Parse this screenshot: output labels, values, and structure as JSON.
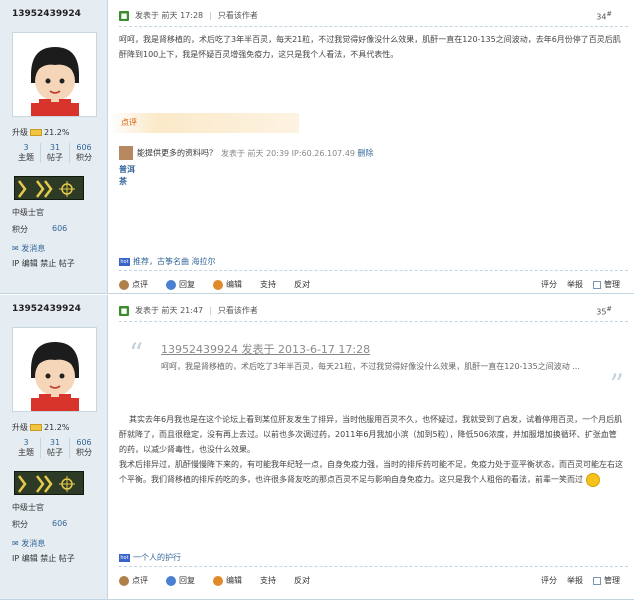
{
  "posts": [
    {
      "author": "13952439924",
      "level_label": "升级",
      "level_pct": "21.2%",
      "stats": [
        {
          "num": "3",
          "label": "主题"
        },
        {
          "num": "31",
          "label": "帖子"
        },
        {
          "num": "606",
          "label": "积分"
        }
      ],
      "rank": "中级士官",
      "points_label": "积分",
      "points": "606",
      "send_msg": "发消息",
      "admin": "IP 编辑 禁止 帖子",
      "posted": "发表于 前天 17:28",
      "only_author": "只看该作者",
      "floor": "34",
      "floor_suffix": "#",
      "content": "呵呵，我是肾移植的，术后吃了3年半百灵，每天21粒，不过我觉得好像没什么效果，肌酐一直在120-135之间波动，去年6月份停了百灵后肌酐降到100上下，我是怀疑百灵增强免疫力，这只是我个人看法，不具代表性。",
      "review_label": "点评",
      "comment": {
        "question": "能提供更多的资料吗？",
        "meta": "发表于 前天 20:39 IP:60.26.107.49",
        "delete": "删除",
        "user_line1": "普洱",
        "user_line2": "茶"
      },
      "link": "推荐，古筝名曲 海拉尔",
      "actions": [
        "点评",
        "回复",
        "编辑",
        "支持",
        "反对"
      ],
      "right_actions": [
        "评分",
        "举报",
        "管理"
      ]
    },
    {
      "author": "13952439924",
      "level_label": "升级",
      "level_pct": "21.2%",
      "stats": [
        {
          "num": "3",
          "label": "主题"
        },
        {
          "num": "31",
          "label": "帖子"
        },
        {
          "num": "606",
          "label": "积分"
        }
      ],
      "rank": "中级士官",
      "points_label": "积分",
      "points": "606",
      "send_msg": "发消息",
      "admin": "IP 编辑 禁止 帖子",
      "posted": "发表于 前天 21:47",
      "only_author": "只看该作者",
      "floor": "35",
      "floor_suffix": "#",
      "quote_head": "13952439924 发表于 2013-6-17 17:28",
      "quote_body": "呵呵，我是肾移植的，术后吃了3年半百灵，每天21粒，不过我觉得好像没什么效果，肌酐一直在120-135之间波动 ...",
      "content": "其实去年6月我也是在这个论坛上看到某位肝友发生了排异，当时他服用百灵不久，也怀疑过，我就受到了启发，试着停用百灵，一个月后肌酐就降了，而且很稳定，没有再上去过。以前也多次调过药，2011年6月我加小滨（加到5粒），降低506浓度，并加服增加换循环、扩张血管的药，以减少肾毒性，也没什么效果。\n我术后排异过，肌酐慢慢降下来的，有可能我年纪轻一点，自身免疫力强，当时的排斥药可能不足，免疫力处于亚平衡状态，而百灵可能左右这个平衡。我们肾移植的排斥药吃的多，也许很多肾友吃的那点百灵不足与影响自身免疫力。这只是我个人粗俗的看法，前辈一笑而过",
      "link": "一个人的护行",
      "actions": [
        "点评",
        "回复",
        "编辑",
        "支持",
        "反对"
      ],
      "right_actions": [
        "评分",
        "举报",
        "管理"
      ]
    }
  ]
}
